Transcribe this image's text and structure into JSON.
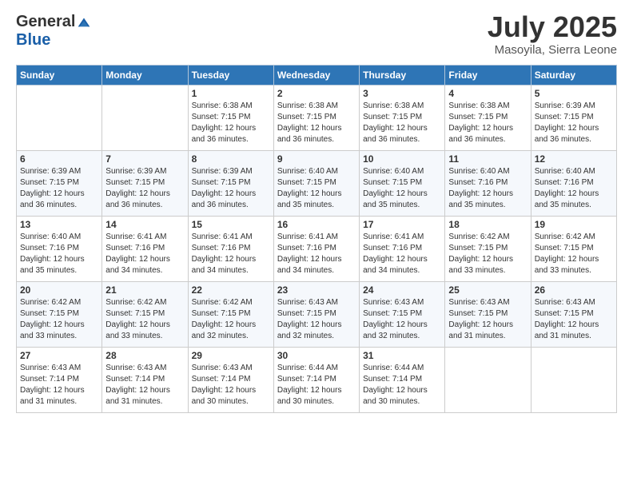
{
  "header": {
    "logo_general": "General",
    "logo_blue": "Blue",
    "month_title": "July 2025",
    "location": "Masoyila, Sierra Leone"
  },
  "days_of_week": [
    "Sunday",
    "Monday",
    "Tuesday",
    "Wednesday",
    "Thursday",
    "Friday",
    "Saturday"
  ],
  "weeks": [
    [
      {
        "day": "",
        "info": ""
      },
      {
        "day": "",
        "info": ""
      },
      {
        "day": "1",
        "info": "Sunrise: 6:38 AM\nSunset: 7:15 PM\nDaylight: 12 hours and 36 minutes."
      },
      {
        "day": "2",
        "info": "Sunrise: 6:38 AM\nSunset: 7:15 PM\nDaylight: 12 hours and 36 minutes."
      },
      {
        "day": "3",
        "info": "Sunrise: 6:38 AM\nSunset: 7:15 PM\nDaylight: 12 hours and 36 minutes."
      },
      {
        "day": "4",
        "info": "Sunrise: 6:38 AM\nSunset: 7:15 PM\nDaylight: 12 hours and 36 minutes."
      },
      {
        "day": "5",
        "info": "Sunrise: 6:39 AM\nSunset: 7:15 PM\nDaylight: 12 hours and 36 minutes."
      }
    ],
    [
      {
        "day": "6",
        "info": "Sunrise: 6:39 AM\nSunset: 7:15 PM\nDaylight: 12 hours and 36 minutes."
      },
      {
        "day": "7",
        "info": "Sunrise: 6:39 AM\nSunset: 7:15 PM\nDaylight: 12 hours and 36 minutes."
      },
      {
        "day": "8",
        "info": "Sunrise: 6:39 AM\nSunset: 7:15 PM\nDaylight: 12 hours and 36 minutes."
      },
      {
        "day": "9",
        "info": "Sunrise: 6:40 AM\nSunset: 7:15 PM\nDaylight: 12 hours and 35 minutes."
      },
      {
        "day": "10",
        "info": "Sunrise: 6:40 AM\nSunset: 7:15 PM\nDaylight: 12 hours and 35 minutes."
      },
      {
        "day": "11",
        "info": "Sunrise: 6:40 AM\nSunset: 7:16 PM\nDaylight: 12 hours and 35 minutes."
      },
      {
        "day": "12",
        "info": "Sunrise: 6:40 AM\nSunset: 7:16 PM\nDaylight: 12 hours and 35 minutes."
      }
    ],
    [
      {
        "day": "13",
        "info": "Sunrise: 6:40 AM\nSunset: 7:16 PM\nDaylight: 12 hours and 35 minutes."
      },
      {
        "day": "14",
        "info": "Sunrise: 6:41 AM\nSunset: 7:16 PM\nDaylight: 12 hours and 34 minutes."
      },
      {
        "day": "15",
        "info": "Sunrise: 6:41 AM\nSunset: 7:16 PM\nDaylight: 12 hours and 34 minutes."
      },
      {
        "day": "16",
        "info": "Sunrise: 6:41 AM\nSunset: 7:16 PM\nDaylight: 12 hours and 34 minutes."
      },
      {
        "day": "17",
        "info": "Sunrise: 6:41 AM\nSunset: 7:16 PM\nDaylight: 12 hours and 34 minutes."
      },
      {
        "day": "18",
        "info": "Sunrise: 6:42 AM\nSunset: 7:15 PM\nDaylight: 12 hours and 33 minutes."
      },
      {
        "day": "19",
        "info": "Sunrise: 6:42 AM\nSunset: 7:15 PM\nDaylight: 12 hours and 33 minutes."
      }
    ],
    [
      {
        "day": "20",
        "info": "Sunrise: 6:42 AM\nSunset: 7:15 PM\nDaylight: 12 hours and 33 minutes."
      },
      {
        "day": "21",
        "info": "Sunrise: 6:42 AM\nSunset: 7:15 PM\nDaylight: 12 hours and 33 minutes."
      },
      {
        "day": "22",
        "info": "Sunrise: 6:42 AM\nSunset: 7:15 PM\nDaylight: 12 hours and 32 minutes."
      },
      {
        "day": "23",
        "info": "Sunrise: 6:43 AM\nSunset: 7:15 PM\nDaylight: 12 hours and 32 minutes."
      },
      {
        "day": "24",
        "info": "Sunrise: 6:43 AM\nSunset: 7:15 PM\nDaylight: 12 hours and 32 minutes."
      },
      {
        "day": "25",
        "info": "Sunrise: 6:43 AM\nSunset: 7:15 PM\nDaylight: 12 hours and 31 minutes."
      },
      {
        "day": "26",
        "info": "Sunrise: 6:43 AM\nSunset: 7:15 PM\nDaylight: 12 hours and 31 minutes."
      }
    ],
    [
      {
        "day": "27",
        "info": "Sunrise: 6:43 AM\nSunset: 7:14 PM\nDaylight: 12 hours and 31 minutes."
      },
      {
        "day": "28",
        "info": "Sunrise: 6:43 AM\nSunset: 7:14 PM\nDaylight: 12 hours and 31 minutes."
      },
      {
        "day": "29",
        "info": "Sunrise: 6:43 AM\nSunset: 7:14 PM\nDaylight: 12 hours and 30 minutes."
      },
      {
        "day": "30",
        "info": "Sunrise: 6:44 AM\nSunset: 7:14 PM\nDaylight: 12 hours and 30 minutes."
      },
      {
        "day": "31",
        "info": "Sunrise: 6:44 AM\nSunset: 7:14 PM\nDaylight: 12 hours and 30 minutes."
      },
      {
        "day": "",
        "info": ""
      },
      {
        "day": "",
        "info": ""
      }
    ]
  ]
}
